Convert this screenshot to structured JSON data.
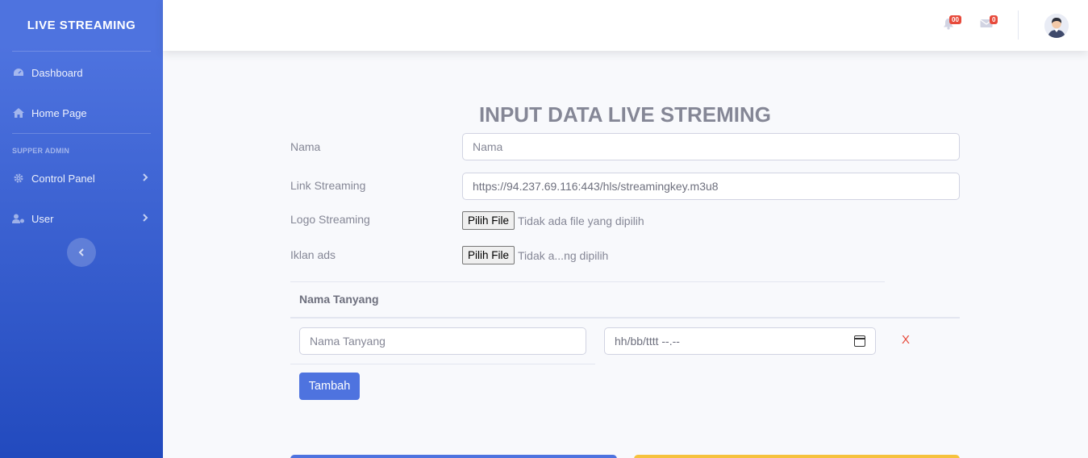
{
  "sidebar": {
    "brand": "LIVE STREAMING",
    "items": [
      {
        "label": "Dashboard",
        "icon": "dashboard-icon"
      },
      {
        "label": "Home Page",
        "icon": "home-icon"
      }
    ],
    "heading": "SUPPER ADMIN",
    "admin_items": [
      {
        "label": "Control Panel",
        "icon": "gear-icon"
      },
      {
        "label": "User",
        "icon": "user-cog-icon"
      }
    ]
  },
  "topbar": {
    "alerts_badge": "00",
    "messages_badge": "0"
  },
  "form": {
    "title": "INPUT DATA LIVE STREMING",
    "nama_label": "Nama",
    "nama_placeholder": "Nama",
    "link_label": "Link Streaming",
    "link_value": "https://94.237.69.116:443/hls/streamingkey.m3u8",
    "logo_label": "Logo Streaming",
    "logo_button": "Pilih File",
    "logo_status": "Tidak ada file yang dipilih",
    "iklan_label": "Iklan ads",
    "iklan_button": "Pilih File",
    "iklan_status": "Tidak a...ng dipilih",
    "table_header": "Nama Tanyang",
    "row_name_placeholder": "Nama Tanyang",
    "row_datetime_placeholder": "hh/bb/tttt  --.--",
    "remove_label": "X",
    "add_button": "Tambah"
  }
}
